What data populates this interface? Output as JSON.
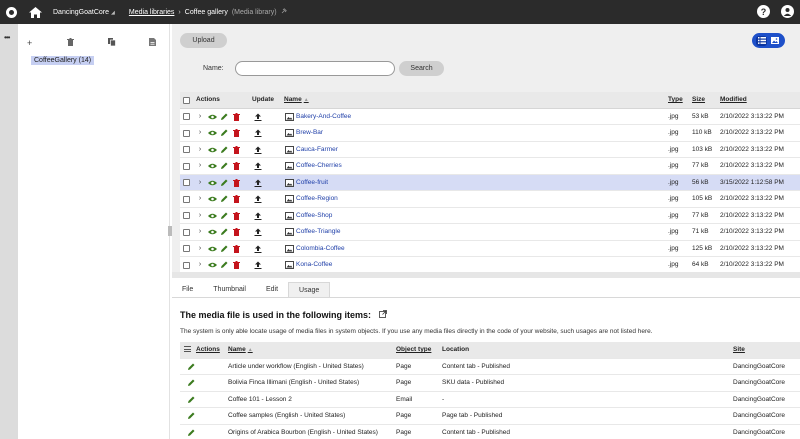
{
  "topbar": {
    "site_name": "DancingGoatCore",
    "breadcrumb_root": "Media libraries",
    "breadcrumb_current": "Coffee gallery",
    "breadcrumb_suffix": "(Media library)",
    "help_label": "?"
  },
  "tree": {
    "node_label": "CoffeeGallery (14)"
  },
  "toolbar": {
    "upload_label": "Upload",
    "name_label": "Name:",
    "name_value": "",
    "search_label": "Search"
  },
  "grid": {
    "headers": {
      "actions": "Actions",
      "update": "Update",
      "name": "Name",
      "type": "Type",
      "size": "Size",
      "modified": "Modified"
    },
    "rows": [
      {
        "name": "Bakery-And-Coffee",
        "type": ".jpg",
        "size": "53 kB",
        "modified": "2/10/2022 3:13:22 PM"
      },
      {
        "name": "Brew-Bar",
        "type": ".jpg",
        "size": "110 kB",
        "modified": "2/10/2022 3:13:22 PM"
      },
      {
        "name": "Cauca-Farmer",
        "type": ".jpg",
        "size": "103 kB",
        "modified": "2/10/2022 3:13:22 PM"
      },
      {
        "name": "Coffee-Cherries",
        "type": ".jpg",
        "size": "77 kB",
        "modified": "2/10/2022 3:13:22 PM"
      },
      {
        "name": "Coffee-fruit",
        "type": ".jpg",
        "size": "56 kB",
        "modified": "3/15/2022 1:12:58 PM"
      },
      {
        "name": "Coffee-Region",
        "type": ".jpg",
        "size": "105 kB",
        "modified": "2/10/2022 3:13:22 PM"
      },
      {
        "name": "Coffee-Shop",
        "type": ".jpg",
        "size": "77 kB",
        "modified": "2/10/2022 3:13:22 PM"
      },
      {
        "name": "Coffee-Triangle",
        "type": ".jpg",
        "size": "71 kB",
        "modified": "2/10/2022 3:13:22 PM"
      },
      {
        "name": "Colombia-Coffee",
        "type": ".jpg",
        "size": "125 kB",
        "modified": "2/10/2022 3:13:22 PM"
      },
      {
        "name": "Kona-Coffee",
        "type": ".jpg",
        "size": "64 kB",
        "modified": "2/10/2022 3:13:22 PM"
      }
    ]
  },
  "tabs": {
    "file": "File",
    "thumbnail": "Thumbnail",
    "edit": "Edit",
    "usage": "Usage"
  },
  "usage": {
    "title": "The media file is used in the following items:",
    "note": "The system is only able locate usage of media files in system objects. If you use any media files directly in the code of your website, such usages are not listed here.",
    "headers": {
      "actions": "Actions",
      "name": "Name",
      "object_type": "Object type",
      "location": "Location",
      "site": "Site"
    },
    "rows": [
      {
        "name": "Article under workflow (English - United States)",
        "object_type": "Page",
        "location": "Content tab - Published",
        "site": "DancingGoatCore"
      },
      {
        "name": "Bolivia Finca Illimani (English - United States)",
        "object_type": "Page",
        "location": "SKU data - Published",
        "site": "DancingGoatCore"
      },
      {
        "name": "Coffee 101 - Lesson 2",
        "object_type": "Email",
        "location": "-",
        "site": "DancingGoatCore"
      },
      {
        "name": "Coffee samples (English - United States)",
        "object_type": "Page",
        "location": "Page tab - Published",
        "site": "DancingGoatCore"
      },
      {
        "name": "Origins of Arabica Bourbon (English - United States)",
        "object_type": "Page",
        "location": "Content tab - Published",
        "site": "DancingGoatCore"
      }
    ]
  },
  "colors": {
    "topbar_bg": "#2b2b2b",
    "accent": "#1e50c9",
    "selected_row": "#d6dcf5",
    "edit_green": "#3b7b1e",
    "delete_red": "#c4141c"
  }
}
